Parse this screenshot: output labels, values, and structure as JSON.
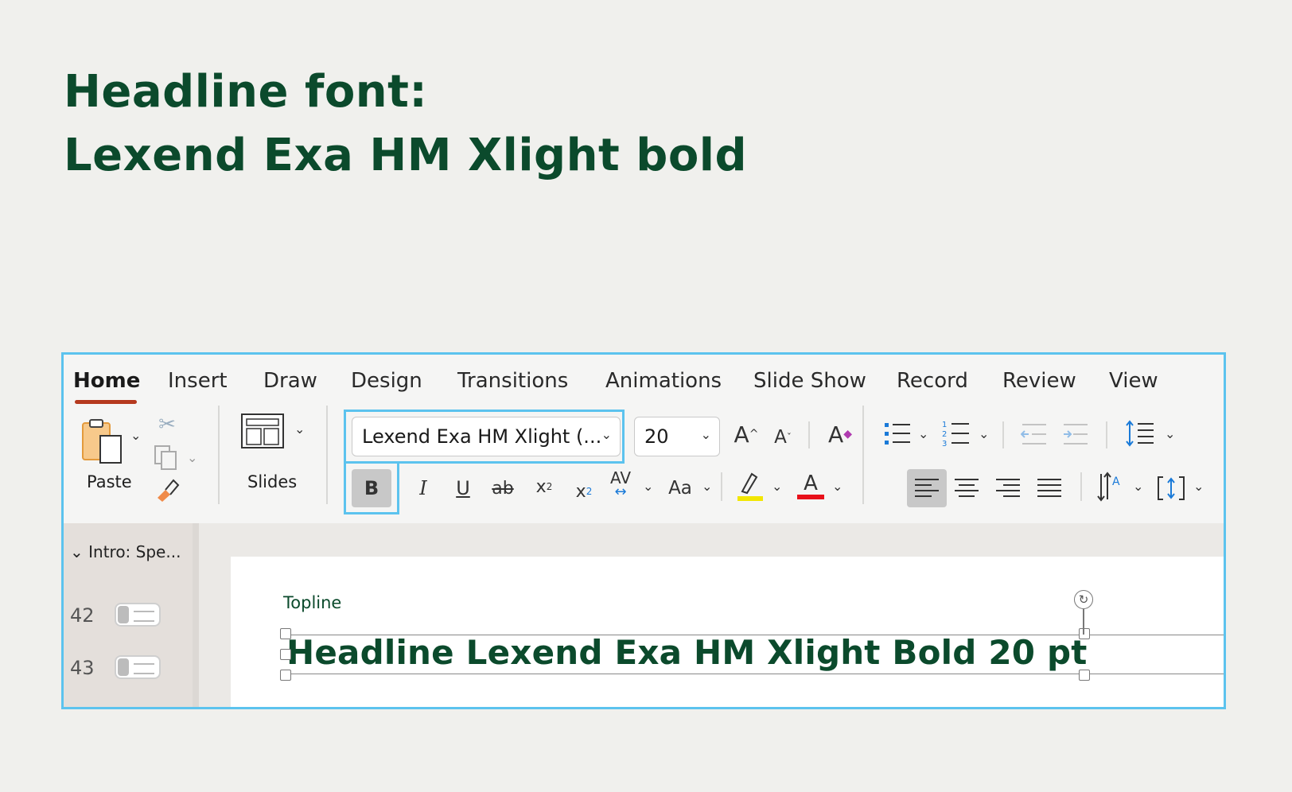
{
  "heading": {
    "line1": "Headline font:",
    "line2": "Lexend Exa HM Xlight bold"
  },
  "tabs": [
    {
      "label": "Home",
      "active": true
    },
    {
      "label": "Insert"
    },
    {
      "label": "Draw"
    },
    {
      "label": "Design"
    },
    {
      "label": "Transitions"
    },
    {
      "label": "Animations"
    },
    {
      "label": "Slide Show"
    },
    {
      "label": "Record"
    },
    {
      "label": "Review"
    },
    {
      "label": "View"
    }
  ],
  "ribbon": {
    "paste_label": "Paste",
    "slides_label": "Slides",
    "font_name": "Lexend Exa HM Xlight (...",
    "font_size": "20",
    "bold_label": "B",
    "italic_label": "I",
    "underline_label": "U",
    "strike_label": "ab",
    "superscript_label": "x",
    "subscript_label": "x",
    "spacing_label": "AV",
    "case_label": "Aa",
    "highlight_color": "#f2e600",
    "font_color": "#e8101a",
    "accent_color": "#5cc3ee"
  },
  "thumbs": {
    "section": "Intro: Spe...",
    "slides": [
      {
        "number": "42"
      },
      {
        "number": "43"
      }
    ]
  },
  "slide": {
    "topline": "Topline",
    "headline": "Headline Lexend Exa HM Xlight Bold 20 pt"
  }
}
